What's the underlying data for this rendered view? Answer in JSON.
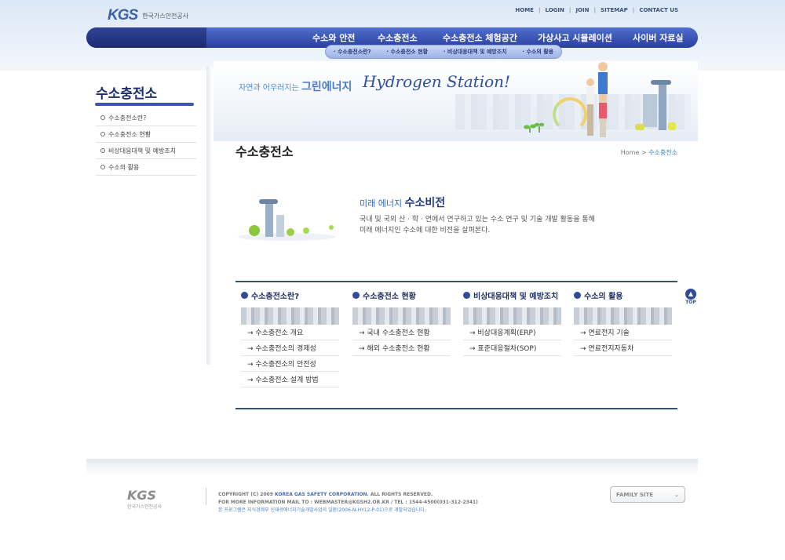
{
  "header": {
    "logo_mark": "KGS",
    "logo_name": "한국가스안전공사",
    "util_links": [
      "HOME",
      "LOGIN",
      "JOIN",
      "SITEMAP",
      "CONTACT US"
    ],
    "gnb": [
      "수소와 안전",
      "수소충전소",
      "수소충전소 체험공간",
      "가상사고 시뮬레이션",
      "사이버 자료실"
    ],
    "gnb_active": "수소충전소",
    "subnav": [
      "수소충전소란?",
      "수소충전소 현황",
      "비상대응대책 및 예방조치",
      "수소의 활용"
    ]
  },
  "lnb": {
    "title": "수소충전소",
    "items": [
      "수소충전소란?",
      "수소충전소 현황",
      "비상대응대책 및 예방조치",
      "수소의 활용"
    ]
  },
  "visual": {
    "kr_text_1": "자연과 어우러지는",
    "kr_text_2": "그린에너지",
    "en_text": "Hydrogen Station!"
  },
  "page": {
    "title": "수소충전소",
    "breadcrumb_home": "Home",
    "breadcrumb_sep": ">",
    "breadcrumb_current": "수소충전소"
  },
  "intro": {
    "title_1": "미래 에너지",
    "title_2": "수소비전",
    "desc_1": "국내 및 국외 산 · 학 · 연에서 연구하고 있는 수소 연구 및 기술 개발 활동을 통해",
    "desc_2": "미래 에너지인 수소에 대한 비전을 살펴본다."
  },
  "columns": [
    {
      "title": "수소충전소란?",
      "links": [
        "→ 수소충전소 개요",
        "→ 수소충전소의 경제성",
        "→ 수소충전소의 안전성",
        "→ 수소충전소 설계 방법"
      ]
    },
    {
      "title": "수소충전소 현황",
      "links": [
        "→ 국내 수소충전소 현황",
        "→ 해외 수소충전소 현황"
      ]
    },
    {
      "title": "비상대응대책 및 예방조치",
      "links": [
        "→ 비상대응계획(ERP)",
        "→ 표준대응절차(SOP)"
      ]
    },
    {
      "title": "수소의 활용",
      "links": [
        "→ 연료전지 기술",
        "→ 연료전지자동차"
      ]
    }
  ],
  "top_button": "TOP",
  "footer": {
    "logo_mark": "KGS",
    "logo_name": "한국가스안전공사",
    "copy_1a": "COPYRIGHT (C) 2009 ",
    "copy_1b": "KOREA GAS SAFETY CORPORATION",
    "copy_1c": ". ALL RIGHTS RESERVED.",
    "copy_2": "FOR MORE INFORMATION MAIL TO : WEBMASTER@KGSH2.OR.KR  /  TEL : 1544-4500(031-312-2341)",
    "copy_3": "본 프로그램은 지식경제부 신재생에너지기술개발사업의 일환(2006-N-HY12-P-01)으로 개발되었습니다.",
    "family_site": "FAMILY SITE",
    "family_arrow": "⌄"
  }
}
